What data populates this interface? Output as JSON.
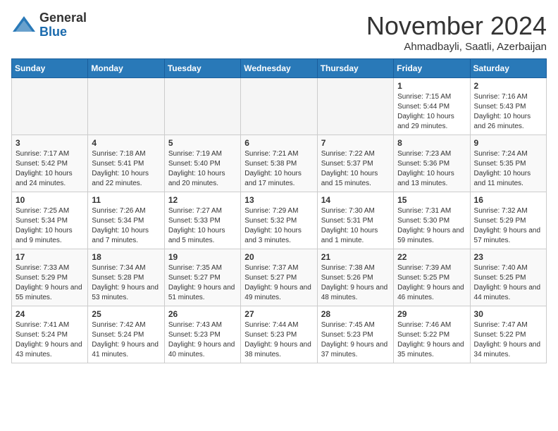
{
  "header": {
    "logo_general": "General",
    "logo_blue": "Blue",
    "month_title": "November 2024",
    "location": "Ahmadbayli, Saatli, Azerbaijan"
  },
  "days_of_week": [
    "Sunday",
    "Monday",
    "Tuesday",
    "Wednesday",
    "Thursday",
    "Friday",
    "Saturday"
  ],
  "weeks": [
    [
      {
        "day": "",
        "info": ""
      },
      {
        "day": "",
        "info": ""
      },
      {
        "day": "",
        "info": ""
      },
      {
        "day": "",
        "info": ""
      },
      {
        "day": "",
        "info": ""
      },
      {
        "day": "1",
        "info": "Sunrise: 7:15 AM\nSunset: 5:44 PM\nDaylight: 10 hours and 29 minutes."
      },
      {
        "day": "2",
        "info": "Sunrise: 7:16 AM\nSunset: 5:43 PM\nDaylight: 10 hours and 26 minutes."
      }
    ],
    [
      {
        "day": "3",
        "info": "Sunrise: 7:17 AM\nSunset: 5:42 PM\nDaylight: 10 hours and 24 minutes."
      },
      {
        "day": "4",
        "info": "Sunrise: 7:18 AM\nSunset: 5:41 PM\nDaylight: 10 hours and 22 minutes."
      },
      {
        "day": "5",
        "info": "Sunrise: 7:19 AM\nSunset: 5:40 PM\nDaylight: 10 hours and 20 minutes."
      },
      {
        "day": "6",
        "info": "Sunrise: 7:21 AM\nSunset: 5:38 PM\nDaylight: 10 hours and 17 minutes."
      },
      {
        "day": "7",
        "info": "Sunrise: 7:22 AM\nSunset: 5:37 PM\nDaylight: 10 hours and 15 minutes."
      },
      {
        "day": "8",
        "info": "Sunrise: 7:23 AM\nSunset: 5:36 PM\nDaylight: 10 hours and 13 minutes."
      },
      {
        "day": "9",
        "info": "Sunrise: 7:24 AM\nSunset: 5:35 PM\nDaylight: 10 hours and 11 minutes."
      }
    ],
    [
      {
        "day": "10",
        "info": "Sunrise: 7:25 AM\nSunset: 5:34 PM\nDaylight: 10 hours and 9 minutes."
      },
      {
        "day": "11",
        "info": "Sunrise: 7:26 AM\nSunset: 5:34 PM\nDaylight: 10 hours and 7 minutes."
      },
      {
        "day": "12",
        "info": "Sunrise: 7:27 AM\nSunset: 5:33 PM\nDaylight: 10 hours and 5 minutes."
      },
      {
        "day": "13",
        "info": "Sunrise: 7:29 AM\nSunset: 5:32 PM\nDaylight: 10 hours and 3 minutes."
      },
      {
        "day": "14",
        "info": "Sunrise: 7:30 AM\nSunset: 5:31 PM\nDaylight: 10 hours and 1 minute."
      },
      {
        "day": "15",
        "info": "Sunrise: 7:31 AM\nSunset: 5:30 PM\nDaylight: 9 hours and 59 minutes."
      },
      {
        "day": "16",
        "info": "Sunrise: 7:32 AM\nSunset: 5:29 PM\nDaylight: 9 hours and 57 minutes."
      }
    ],
    [
      {
        "day": "17",
        "info": "Sunrise: 7:33 AM\nSunset: 5:29 PM\nDaylight: 9 hours and 55 minutes."
      },
      {
        "day": "18",
        "info": "Sunrise: 7:34 AM\nSunset: 5:28 PM\nDaylight: 9 hours and 53 minutes."
      },
      {
        "day": "19",
        "info": "Sunrise: 7:35 AM\nSunset: 5:27 PM\nDaylight: 9 hours and 51 minutes."
      },
      {
        "day": "20",
        "info": "Sunrise: 7:37 AM\nSunset: 5:27 PM\nDaylight: 9 hours and 49 minutes."
      },
      {
        "day": "21",
        "info": "Sunrise: 7:38 AM\nSunset: 5:26 PM\nDaylight: 9 hours and 48 minutes."
      },
      {
        "day": "22",
        "info": "Sunrise: 7:39 AM\nSunset: 5:25 PM\nDaylight: 9 hours and 46 minutes."
      },
      {
        "day": "23",
        "info": "Sunrise: 7:40 AM\nSunset: 5:25 PM\nDaylight: 9 hours and 44 minutes."
      }
    ],
    [
      {
        "day": "24",
        "info": "Sunrise: 7:41 AM\nSunset: 5:24 PM\nDaylight: 9 hours and 43 minutes."
      },
      {
        "day": "25",
        "info": "Sunrise: 7:42 AM\nSunset: 5:24 PM\nDaylight: 9 hours and 41 minutes."
      },
      {
        "day": "26",
        "info": "Sunrise: 7:43 AM\nSunset: 5:23 PM\nDaylight: 9 hours and 40 minutes."
      },
      {
        "day": "27",
        "info": "Sunrise: 7:44 AM\nSunset: 5:23 PM\nDaylight: 9 hours and 38 minutes."
      },
      {
        "day": "28",
        "info": "Sunrise: 7:45 AM\nSunset: 5:23 PM\nDaylight: 9 hours and 37 minutes."
      },
      {
        "day": "29",
        "info": "Sunrise: 7:46 AM\nSunset: 5:22 PM\nDaylight: 9 hours and 35 minutes."
      },
      {
        "day": "30",
        "info": "Sunrise: 7:47 AM\nSunset: 5:22 PM\nDaylight: 9 hours and 34 minutes."
      }
    ]
  ]
}
